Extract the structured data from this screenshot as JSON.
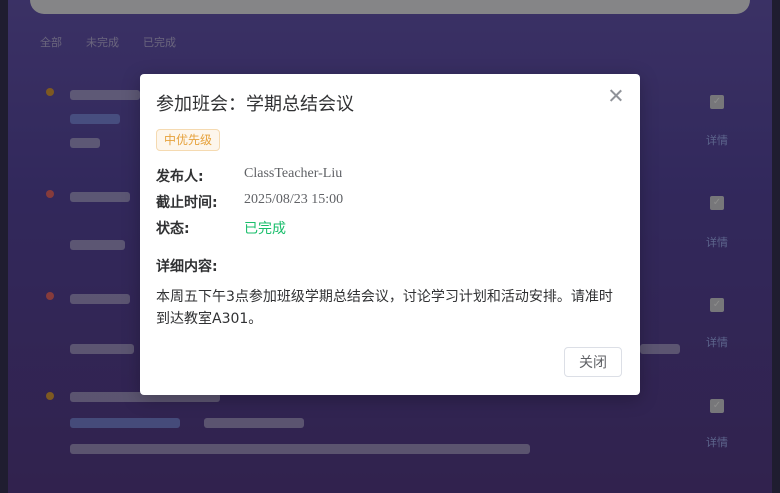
{
  "background": {
    "filters": [
      "全部",
      "未完成",
      "已完成"
    ],
    "detail_link": "详情",
    "check_icon": "checkbox-checked-icon",
    "row_colors": [
      "#e6a23c",
      "#f56c6c",
      "#f56c6c",
      "#e6a23c"
    ]
  },
  "dialog": {
    "title": "参加班会：学期总结会议",
    "priority": "中优先级",
    "fields": [
      {
        "label": "发布人:",
        "value": "ClassTeacher-Liu"
      },
      {
        "label": "截止时间:",
        "value": "2025/08/23 15:00"
      },
      {
        "label": "状态:",
        "value": "已完成"
      }
    ],
    "content_label": "详细内容:",
    "content": "本周五下午3点参加班级学期总结会议，讨论学习计划和活动安排。请准时到达教室A301。",
    "close_button": "关闭",
    "close_icon": "close-icon",
    "status_color": "#19be6b",
    "priority_color": "#e6a23c"
  }
}
